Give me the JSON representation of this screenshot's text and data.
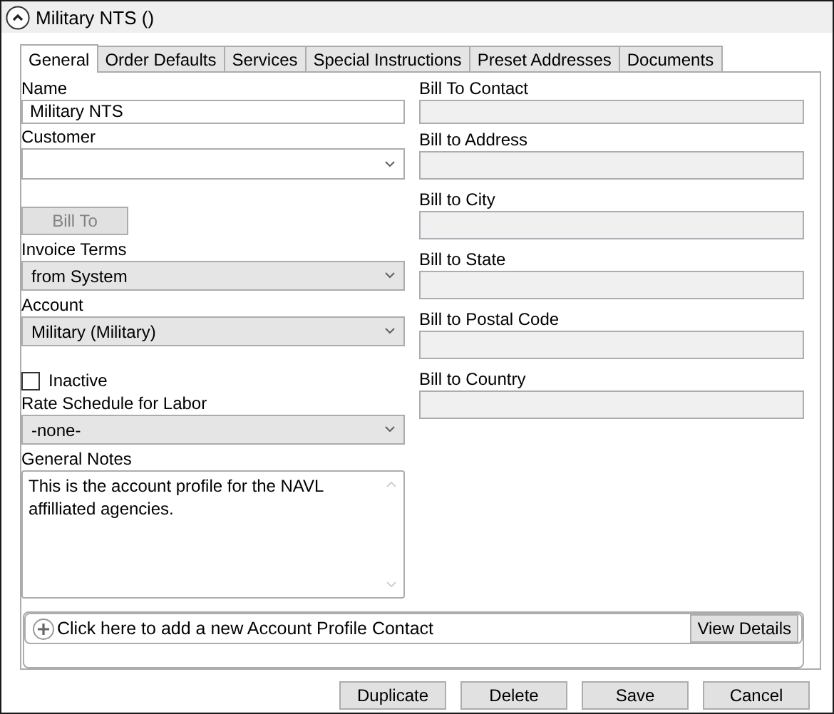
{
  "window": {
    "title": "Military NTS ()",
    "expanded": true
  },
  "tabs": [
    {
      "label": "General",
      "selected": true
    },
    {
      "label": "Order Defaults",
      "selected": false
    },
    {
      "label": "Services",
      "selected": false
    },
    {
      "label": "Special Instructions",
      "selected": false
    },
    {
      "label": "Preset Addresses",
      "selected": false
    },
    {
      "label": "Documents",
      "selected": false
    }
  ],
  "left_fields": [
    {
      "kind": "text",
      "label": "Name",
      "value": "Military NTS"
    },
    {
      "kind": "combo",
      "label": "Customer",
      "disabled": false
    },
    {
      "kind": "button",
      "label": "Bill To",
      "disabled": true
    },
    {
      "kind": "combo",
      "label": "Invoice Terms",
      "value": "from System",
      "disabled": true
    },
    {
      "kind": "combo",
      "label": "Account",
      "value": "Military (Military)",
      "disabled": true
    },
    {
      "kind": "checkbox",
      "label": "Inactive",
      "checked": false
    },
    {
      "kind": "combo",
      "label": "Rate Schedule for Labor",
      "value": "-none-",
      "disabled": true
    },
    {
      "kind": "textarea",
      "label": "General Notes",
      "value": "This is the account profile for the NAVL affilliated agencies."
    }
  ],
  "right_fields": [
    {
      "label": "Bill To Contact"
    },
    {
      "label": "Bill to Address"
    },
    {
      "label": "Bill to City"
    },
    {
      "label": "Bill to State"
    },
    {
      "label": "Bill to Postal Code"
    },
    {
      "label": "Bill to Country"
    }
  ],
  "contacts": {
    "add_text": "Click here to add a new Account Profile Contact",
    "details_button": "View Details"
  },
  "buttons": [
    "Duplicate",
    "Delete",
    "Save",
    "Cancel"
  ]
}
